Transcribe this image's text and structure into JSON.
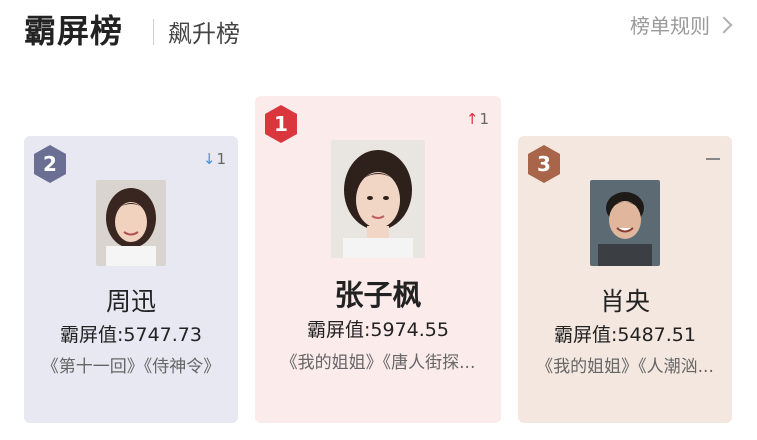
{
  "header": {
    "active_tab": "霸屏榜",
    "inactive_tab": "飙升榜",
    "rules_link": "榜单规则"
  },
  "colors": {
    "rank1_badge": "#d9363e",
    "rank2_badge": "#6a6f93",
    "rank3_badge": "#a8654a",
    "up_arrow": "#d9363e",
    "down_arrow": "#4a90d9"
  },
  "cards": [
    {
      "rank": "1",
      "trend_arrow": "↑",
      "trend_value": "1",
      "name": "张子枫",
      "score": "霸屏值:5974.55",
      "works": "《我的姐姐》《唐人街探..."
    },
    {
      "rank": "2",
      "trend_arrow": "↓",
      "trend_value": "1",
      "name": "周迅",
      "score": "霸屏值:5747.73",
      "works": "《第十一回》《侍神令》"
    },
    {
      "rank": "3",
      "trend_arrow": "—",
      "trend_value": "",
      "name": "肖央",
      "score": "霸屏值:5487.51",
      "works": "《我的姐姐》《人潮汹..."
    }
  ]
}
